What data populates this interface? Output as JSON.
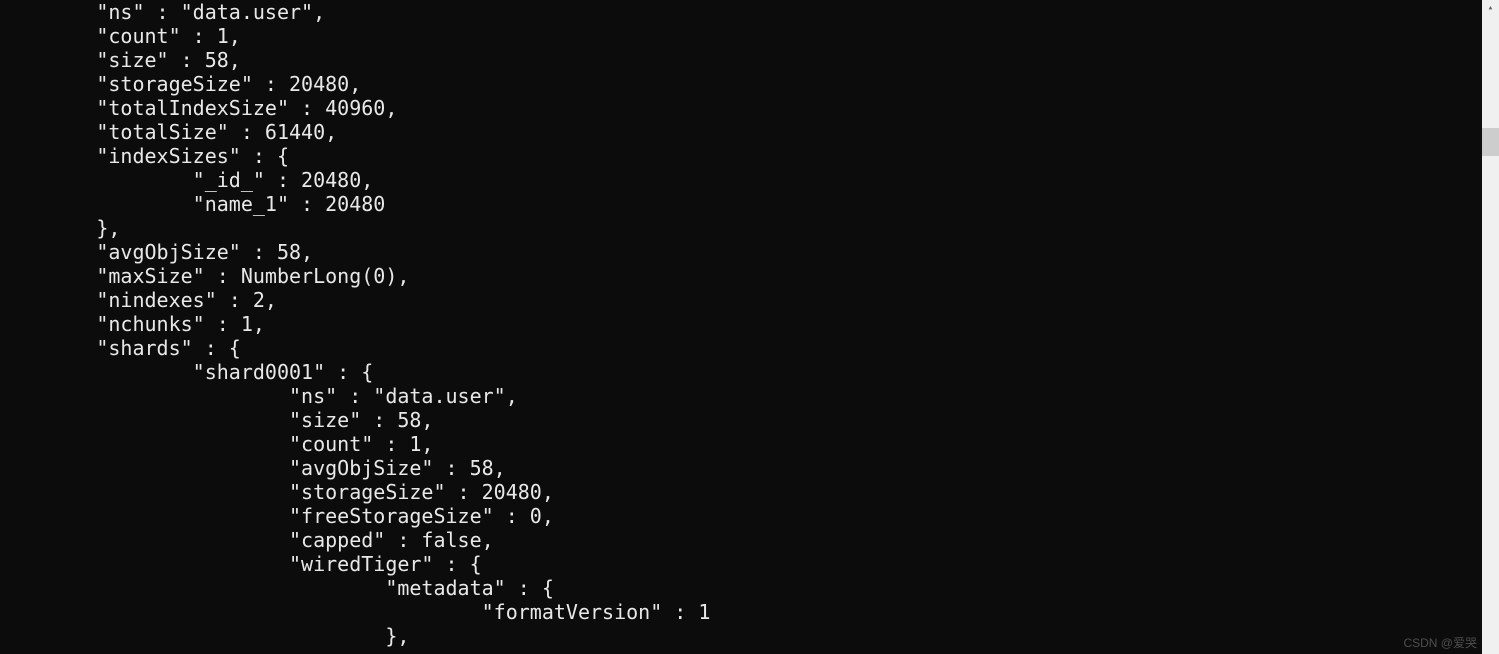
{
  "terminal": {
    "lines": [
      "        \"ns\" : \"data.user\",",
      "        \"count\" : 1,",
      "        \"size\" : 58,",
      "        \"storageSize\" : 20480,",
      "        \"totalIndexSize\" : 40960,",
      "        \"totalSize\" : 61440,",
      "        \"indexSizes\" : {",
      "                \"_id_\" : 20480,",
      "                \"name_1\" : 20480",
      "        },",
      "        \"avgObjSize\" : 58,",
      "        \"maxSize\" : NumberLong(0),",
      "        \"nindexes\" : 2,",
      "        \"nchunks\" : 1,",
      "        \"shards\" : {",
      "                \"shard0001\" : {",
      "                        \"ns\" : \"data.user\",",
      "                        \"size\" : 58,",
      "                        \"count\" : 1,",
      "                        \"avgObjSize\" : 58,",
      "                        \"storageSize\" : 20480,",
      "                        \"freeStorageSize\" : 0,",
      "                        \"capped\" : false,",
      "                        \"wiredTiger\" : {",
      "                                \"metadata\" : {",
      "                                        \"formatVersion\" : 1",
      "                                },"
    ]
  },
  "scrollbar": {
    "up_arrow": "▴",
    "down_arrow": "▾"
  },
  "watermark": {
    "text": "CSDN @爱哭"
  }
}
